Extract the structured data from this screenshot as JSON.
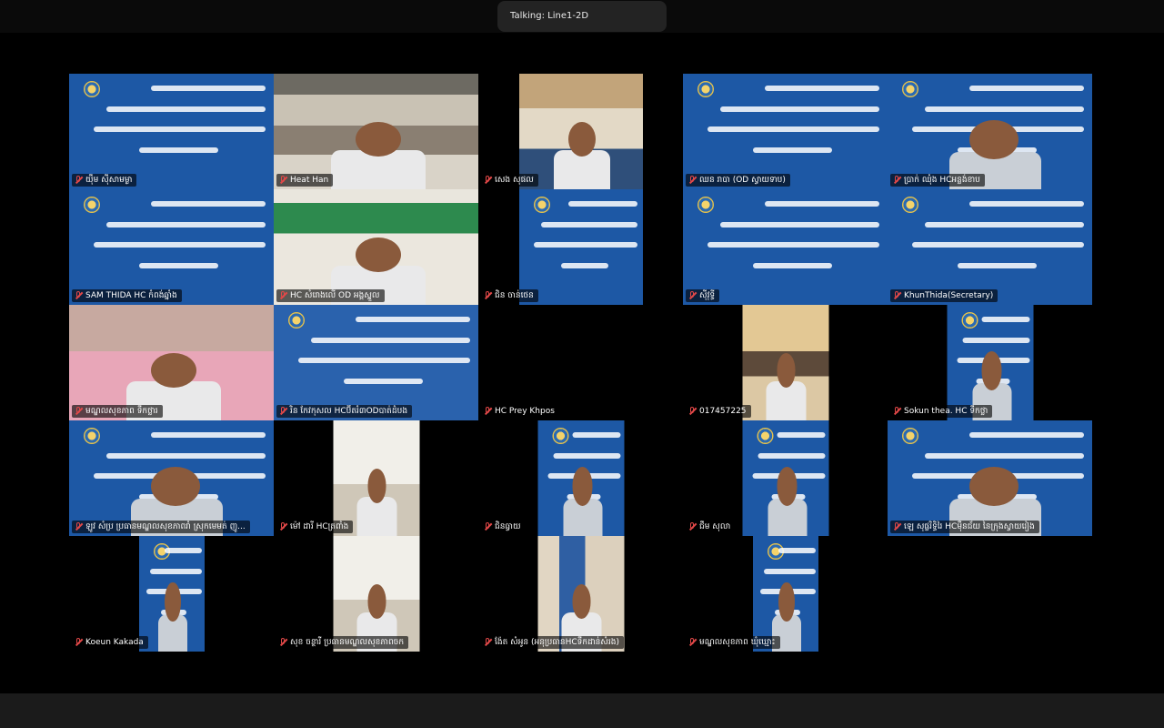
{
  "talking": "Talking: Line1-2D",
  "tiles": [
    {
      "name": "យ៉ឹម ស៊ីសាមម្ងា",
      "style": "slide",
      "width": "full"
    },
    {
      "name": "Heat Han",
      "style": "photo-room",
      "width": "full"
    },
    {
      "name": "សេង សុផល",
      "style": "photo-office",
      "width": "w136"
    },
    {
      "name": "ឈន រាបា (OD ស្វាយទាប)",
      "style": "slide",
      "width": "full"
    },
    {
      "name": "ប្រាក់ ឈុំង HCអន្លង់ខាប",
      "style": "slide-person",
      "width": "full"
    },
    {
      "name": "SAM THIDA HC កំពង់ឆ្នាំង",
      "style": "slide",
      "width": "full"
    },
    {
      "name": "HC សំរោងលើ OD អង្គស្នួល",
      "style": "photo-green",
      "width": "full"
    },
    {
      "name": "ជិន ចាន់ថេន",
      "style": "slide",
      "width": "w136"
    },
    {
      "name": "ស៊ីវុទ្ធី",
      "style": "slide",
      "width": "full"
    },
    {
      "name": "KhunThida(Secretary)",
      "style": "slide",
      "width": "full"
    },
    {
      "name": "មណ្ឌលសុខភាព ទឹកថ្លារ",
      "style": "photo-pink",
      "width": "full"
    },
    {
      "name": "រិន កែវកុសល HCប៊ីតរំ៣ODបាត់ដំបង",
      "style": "slide-dark",
      "width": "full"
    },
    {
      "name": "HC Prey Khpos",
      "style": "empty",
      "width": "full"
    },
    {
      "name": "017457225",
      "style": "photo-window",
      "width": "w95"
    },
    {
      "name": "Sokun thea. HC ទឹកថ្លា",
      "style": "slide-person",
      "width": "w95"
    },
    {
      "name": "ឡូវ សំប្រ ប្រធានមណ្ឌលសុខភាពរាំ ស្រុកមេមត់ ញូ...",
      "style": "slide-person",
      "width": "full"
    },
    {
      "name": "ម៉ៅ ដារី HCត្រពាំង",
      "style": "photo-wall",
      "width": "w95"
    },
    {
      "name": "ជិនធ្វាយ",
      "style": "slide-person",
      "width": "w95"
    },
    {
      "name": "ជឹម សុលា",
      "style": "slide-person",
      "width": "w95"
    },
    {
      "name": "ឡេ សុផ្លរិទ្ធិរៃ HCម៉ឺនជ័យ នៃក្រុងស្វាយរៀង",
      "style": "slide-person",
      "width": "full"
    },
    {
      "name": "Koeun Kakada",
      "style": "slide-person",
      "width": "w72"
    },
    {
      "name": "សុខ ចន្ថារី ប្រធានមណ្ឌលសុខភាពចក",
      "style": "photo-wall",
      "width": "w95"
    },
    {
      "name": "ង៉ែត សំអូន (អនុប្រធានHCទឹកដាន់សំរង)",
      "style": "photo-curtain",
      "width": "w95"
    },
    {
      "name": "មណ្ឌលសុខភាព ឃុំឃ្មោះ",
      "style": "slide-person",
      "width": "w72"
    },
    {
      "name": "",
      "style": "empty",
      "width": "full"
    }
  ]
}
